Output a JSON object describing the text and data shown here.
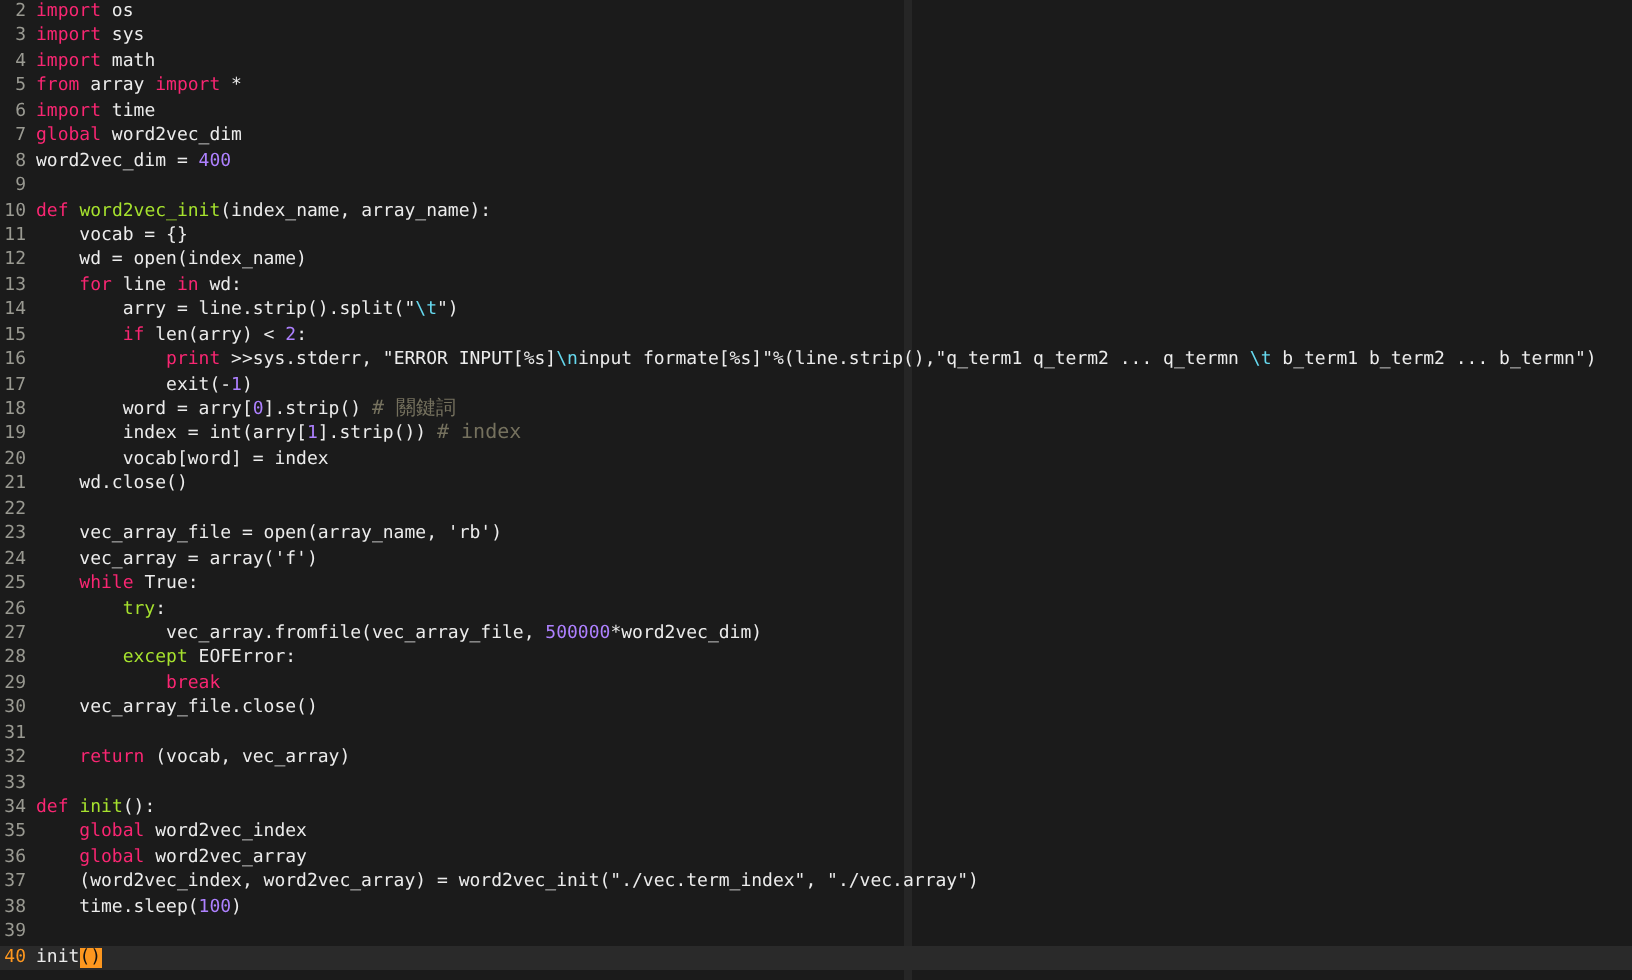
{
  "lines": [
    {
      "number": "2",
      "current": false,
      "tokens": [
        {
          "kind": "keyword",
          "text": "import"
        },
        {
          "kind": "plain",
          "text": " os"
        }
      ]
    },
    {
      "number": "3",
      "current": false,
      "tokens": [
        {
          "kind": "keyword",
          "text": "import"
        },
        {
          "kind": "plain",
          "text": " sys"
        }
      ]
    },
    {
      "number": "4",
      "current": false,
      "tokens": [
        {
          "kind": "keyword",
          "text": "import"
        },
        {
          "kind": "plain",
          "text": " math"
        }
      ]
    },
    {
      "number": "5",
      "current": false,
      "tokens": [
        {
          "kind": "keyword",
          "text": "from"
        },
        {
          "kind": "plain",
          "text": " array "
        },
        {
          "kind": "keyword",
          "text": "import"
        },
        {
          "kind": "plain",
          "text": " *"
        }
      ]
    },
    {
      "number": "6",
      "current": false,
      "tokens": [
        {
          "kind": "keyword",
          "text": "import"
        },
        {
          "kind": "plain",
          "text": " time"
        }
      ]
    },
    {
      "number": "7",
      "current": false,
      "tokens": [
        {
          "kind": "keyword",
          "text": "global"
        },
        {
          "kind": "plain",
          "text": " word2vec_dim"
        }
      ]
    },
    {
      "number": "8",
      "current": false,
      "tokens": [
        {
          "kind": "plain",
          "text": "word2vec_dim = "
        },
        {
          "kind": "number",
          "text": "400"
        }
      ]
    },
    {
      "number": "9",
      "current": false
    },
    {
      "number": "10",
      "current": false,
      "tokens": [
        {
          "kind": "keyword",
          "text": "def "
        },
        {
          "kind": "function",
          "text": "word2vec_init"
        },
        {
          "kind": "plain",
          "text": "(index_name, array_name):"
        }
      ]
    },
    {
      "number": "11",
      "current": false,
      "tokens": [
        {
          "kind": "plain",
          "text": "    vocab = {}"
        }
      ]
    },
    {
      "number": "12",
      "current": false,
      "tokens": [
        {
          "kind": "plain",
          "text": "    wd = open(index_name)"
        }
      ]
    },
    {
      "number": "13",
      "current": false,
      "tokens": [
        {
          "kind": "keyword",
          "text": "    for"
        },
        {
          "kind": "plain",
          "text": " line "
        },
        {
          "kind": "keyword",
          "text": "in"
        },
        {
          "kind": "plain",
          "text": " wd:"
        }
      ]
    },
    {
      "number": "14",
      "current": false,
      "tokens": [
        {
          "kind": "plain",
          "text": "        arry = line.strip().split(\""
        },
        {
          "kind": "escape",
          "text": "\\t"
        },
        {
          "kind": "plain",
          "text": "\")"
        }
      ]
    },
    {
      "number": "15",
      "current": false,
      "tokens": [
        {
          "kind": "keyword",
          "text": "        if"
        },
        {
          "kind": "plain",
          "text": " len(arry) < "
        },
        {
          "kind": "number",
          "text": "2"
        },
        {
          "kind": "plain",
          "text": ":"
        }
      ]
    },
    {
      "number": "16",
      "current": false,
      "tokens": [
        {
          "kind": "keyword",
          "text": "            print"
        },
        {
          "kind": "plain",
          "text": " >>sys.stderr, \"ERROR INPUT[%s]"
        },
        {
          "kind": "escape",
          "text": "\\n"
        },
        {
          "kind": "plain",
          "text": "input formate[%s]\"%(line.strip(),\"q_term1 q_term2 ... q_termn "
        },
        {
          "kind": "escape",
          "text": "\\t"
        },
        {
          "kind": "plain",
          "text": " b_term1 b_term2 ... b_termn\")"
        }
      ]
    },
    {
      "number": "17",
      "current": false,
      "tokens": [
        {
          "kind": "plain",
          "text": "            exit(-"
        },
        {
          "kind": "number",
          "text": "1"
        },
        {
          "kind": "plain",
          "text": ")"
        }
      ]
    },
    {
      "number": "18",
      "current": false,
      "tokens": [
        {
          "kind": "plain",
          "text": "        word = arry["
        },
        {
          "kind": "number",
          "text": "0"
        },
        {
          "kind": "plain",
          "text": "].strip() "
        },
        {
          "kind": "comment",
          "text": "# 關鍵詞"
        }
      ]
    },
    {
      "number": "19",
      "current": false,
      "tokens": [
        {
          "kind": "plain",
          "text": "        index = int(arry["
        },
        {
          "kind": "number",
          "text": "1"
        },
        {
          "kind": "plain",
          "text": "].strip()) "
        },
        {
          "kind": "comment",
          "text": "# index"
        }
      ]
    },
    {
      "number": "20",
      "current": false,
      "tokens": [
        {
          "kind": "plain",
          "text": "        vocab[word] = index"
        }
      ]
    },
    {
      "number": "21",
      "current": false,
      "tokens": [
        {
          "kind": "plain",
          "text": "    wd.close()"
        }
      ]
    },
    {
      "number": "22",
      "current": false
    },
    {
      "number": "23",
      "current": false,
      "tokens": [
        {
          "kind": "plain",
          "text": "    vec_array_file = open(array_name, 'rb')"
        }
      ]
    },
    {
      "number": "24",
      "current": false,
      "tokens": [
        {
          "kind": "plain",
          "text": "    vec_array = array('f')"
        }
      ]
    },
    {
      "number": "25",
      "current": false,
      "tokens": [
        {
          "kind": "keyword",
          "text": "    while"
        },
        {
          "kind": "plain",
          "text": " True:"
        }
      ]
    },
    {
      "number": "26",
      "current": false,
      "tokens": [
        {
          "kind": "function",
          "text": "        try"
        },
        {
          "kind": "plain",
          "text": ":"
        }
      ]
    },
    {
      "number": "27",
      "current": false,
      "tokens": [
        {
          "kind": "plain",
          "text": "            vec_array.fromfile(vec_array_file, "
        },
        {
          "kind": "number",
          "text": "500000"
        },
        {
          "kind": "plain",
          "text": "*word2vec_dim)"
        }
      ]
    },
    {
      "number": "28",
      "current": false,
      "tokens": [
        {
          "kind": "function",
          "text": "        except"
        },
        {
          "kind": "plain",
          "text": " EOFError:"
        }
      ]
    },
    {
      "number": "29",
      "current": false,
      "tokens": [
        {
          "kind": "keyword",
          "text": "            break"
        }
      ]
    },
    {
      "number": "30",
      "current": false,
      "tokens": [
        {
          "kind": "plain",
          "text": "    vec_array_file.close()"
        }
      ]
    },
    {
      "number": "31",
      "current": false
    },
    {
      "number": "32",
      "current": false,
      "tokens": [
        {
          "kind": "keyword",
          "text": "    return"
        },
        {
          "kind": "plain",
          "text": " (vocab, vec_array)"
        }
      ]
    },
    {
      "number": "33",
      "current": false
    },
    {
      "number": "34",
      "current": false,
      "tokens": [
        {
          "kind": "keyword",
          "text": "def "
        },
        {
          "kind": "function",
          "text": "init"
        },
        {
          "kind": "plain",
          "text": "():"
        }
      ]
    },
    {
      "number": "35",
      "current": false,
      "tokens": [
        {
          "kind": "keyword",
          "text": "    global"
        },
        {
          "kind": "plain",
          "text": " word2vec_index"
        }
      ]
    },
    {
      "number": "36",
      "current": false,
      "tokens": [
        {
          "kind": "keyword",
          "text": "    global"
        },
        {
          "kind": "plain",
          "text": " word2vec_array"
        }
      ]
    },
    {
      "number": "37",
      "current": false,
      "tokens": [
        {
          "kind": "plain",
          "text": "    (word2vec_index, word2vec_array) = word2vec_init(\"./vec.term_index\", \"./vec.array\")"
        }
      ]
    },
    {
      "number": "38",
      "current": false,
      "tokens": [
        {
          "kind": "plain",
          "text": "    time.sleep("
        },
        {
          "kind": "number",
          "text": "100"
        },
        {
          "kind": "plain",
          "text": ")"
        }
      ]
    },
    {
      "number": "39",
      "current": false
    },
    {
      "number": "40",
      "current": true,
      "tokens": [
        {
          "kind": "plain",
          "text": "init"
        },
        {
          "kind": "bracket_match",
          "text": "()"
        }
      ]
    }
  ]
}
